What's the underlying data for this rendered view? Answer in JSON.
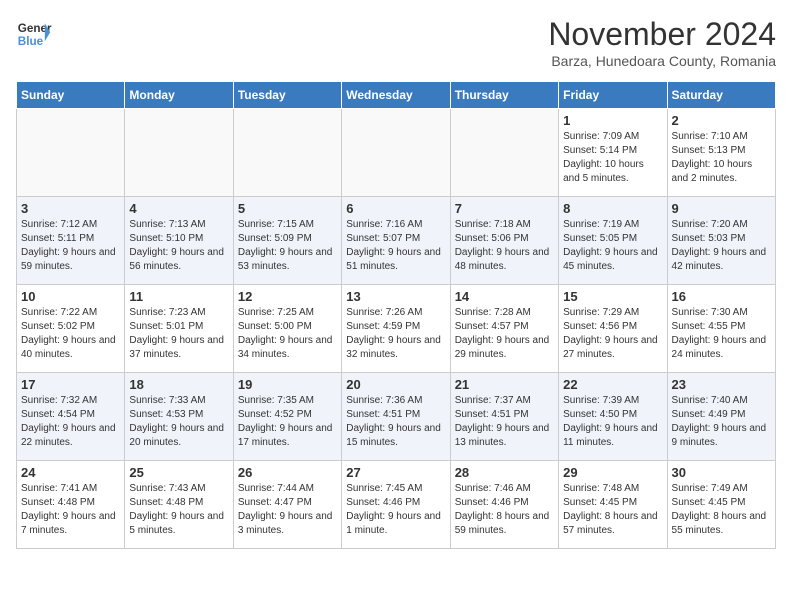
{
  "logo": {
    "line1": "General",
    "line2": "Blue"
  },
  "title": "November 2024",
  "subtitle": "Barza, Hunedoara County, Romania",
  "days_of_week": [
    "Sunday",
    "Monday",
    "Tuesday",
    "Wednesday",
    "Thursday",
    "Friday",
    "Saturday"
  ],
  "weeks": [
    [
      {
        "day": "",
        "info": ""
      },
      {
        "day": "",
        "info": ""
      },
      {
        "day": "",
        "info": ""
      },
      {
        "day": "",
        "info": ""
      },
      {
        "day": "",
        "info": ""
      },
      {
        "day": "1",
        "info": "Sunrise: 7:09 AM\nSunset: 5:14 PM\nDaylight: 10 hours and 5 minutes."
      },
      {
        "day": "2",
        "info": "Sunrise: 7:10 AM\nSunset: 5:13 PM\nDaylight: 10 hours and 2 minutes."
      }
    ],
    [
      {
        "day": "3",
        "info": "Sunrise: 7:12 AM\nSunset: 5:11 PM\nDaylight: 9 hours and 59 minutes."
      },
      {
        "day": "4",
        "info": "Sunrise: 7:13 AM\nSunset: 5:10 PM\nDaylight: 9 hours and 56 minutes."
      },
      {
        "day": "5",
        "info": "Sunrise: 7:15 AM\nSunset: 5:09 PM\nDaylight: 9 hours and 53 minutes."
      },
      {
        "day": "6",
        "info": "Sunrise: 7:16 AM\nSunset: 5:07 PM\nDaylight: 9 hours and 51 minutes."
      },
      {
        "day": "7",
        "info": "Sunrise: 7:18 AM\nSunset: 5:06 PM\nDaylight: 9 hours and 48 minutes."
      },
      {
        "day": "8",
        "info": "Sunrise: 7:19 AM\nSunset: 5:05 PM\nDaylight: 9 hours and 45 minutes."
      },
      {
        "day": "9",
        "info": "Sunrise: 7:20 AM\nSunset: 5:03 PM\nDaylight: 9 hours and 42 minutes."
      }
    ],
    [
      {
        "day": "10",
        "info": "Sunrise: 7:22 AM\nSunset: 5:02 PM\nDaylight: 9 hours and 40 minutes."
      },
      {
        "day": "11",
        "info": "Sunrise: 7:23 AM\nSunset: 5:01 PM\nDaylight: 9 hours and 37 minutes."
      },
      {
        "day": "12",
        "info": "Sunrise: 7:25 AM\nSunset: 5:00 PM\nDaylight: 9 hours and 34 minutes."
      },
      {
        "day": "13",
        "info": "Sunrise: 7:26 AM\nSunset: 4:59 PM\nDaylight: 9 hours and 32 minutes."
      },
      {
        "day": "14",
        "info": "Sunrise: 7:28 AM\nSunset: 4:57 PM\nDaylight: 9 hours and 29 minutes."
      },
      {
        "day": "15",
        "info": "Sunrise: 7:29 AM\nSunset: 4:56 PM\nDaylight: 9 hours and 27 minutes."
      },
      {
        "day": "16",
        "info": "Sunrise: 7:30 AM\nSunset: 4:55 PM\nDaylight: 9 hours and 24 minutes."
      }
    ],
    [
      {
        "day": "17",
        "info": "Sunrise: 7:32 AM\nSunset: 4:54 PM\nDaylight: 9 hours and 22 minutes."
      },
      {
        "day": "18",
        "info": "Sunrise: 7:33 AM\nSunset: 4:53 PM\nDaylight: 9 hours and 20 minutes."
      },
      {
        "day": "19",
        "info": "Sunrise: 7:35 AM\nSunset: 4:52 PM\nDaylight: 9 hours and 17 minutes."
      },
      {
        "day": "20",
        "info": "Sunrise: 7:36 AM\nSunset: 4:51 PM\nDaylight: 9 hours and 15 minutes."
      },
      {
        "day": "21",
        "info": "Sunrise: 7:37 AM\nSunset: 4:51 PM\nDaylight: 9 hours and 13 minutes."
      },
      {
        "day": "22",
        "info": "Sunrise: 7:39 AM\nSunset: 4:50 PM\nDaylight: 9 hours and 11 minutes."
      },
      {
        "day": "23",
        "info": "Sunrise: 7:40 AM\nSunset: 4:49 PM\nDaylight: 9 hours and 9 minutes."
      }
    ],
    [
      {
        "day": "24",
        "info": "Sunrise: 7:41 AM\nSunset: 4:48 PM\nDaylight: 9 hours and 7 minutes."
      },
      {
        "day": "25",
        "info": "Sunrise: 7:43 AM\nSunset: 4:48 PM\nDaylight: 9 hours and 5 minutes."
      },
      {
        "day": "26",
        "info": "Sunrise: 7:44 AM\nSunset: 4:47 PM\nDaylight: 9 hours and 3 minutes."
      },
      {
        "day": "27",
        "info": "Sunrise: 7:45 AM\nSunset: 4:46 PM\nDaylight: 9 hours and 1 minute."
      },
      {
        "day": "28",
        "info": "Sunrise: 7:46 AM\nSunset: 4:46 PM\nDaylight: 8 hours and 59 minutes."
      },
      {
        "day": "29",
        "info": "Sunrise: 7:48 AM\nSunset: 4:45 PM\nDaylight: 8 hours and 57 minutes."
      },
      {
        "day": "30",
        "info": "Sunrise: 7:49 AM\nSunset: 4:45 PM\nDaylight: 8 hours and 55 minutes."
      }
    ]
  ]
}
